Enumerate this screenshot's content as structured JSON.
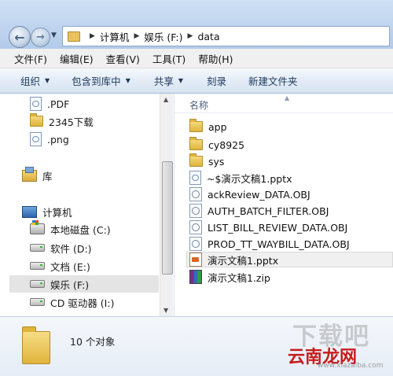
{
  "address": {
    "crumbs": [
      "计算机",
      "娱乐 (F:)",
      "data"
    ]
  },
  "menu": [
    "文件(F)",
    "编辑(E)",
    "查看(V)",
    "工具(T)",
    "帮助(H)"
  ],
  "commands": [
    {
      "label": "组织",
      "dropdown": true
    },
    {
      "label": "包含到库中",
      "dropdown": true
    },
    {
      "label": "共享",
      "dropdown": true
    },
    {
      "label": "刻录",
      "dropdown": false
    },
    {
      "label": "新建文件夹",
      "dropdown": false
    }
  ],
  "nav": {
    "items": [
      {
        "label": ".PDF",
        "icon": "file-icon"
      },
      {
        "label": "2345下载",
        "icon": "folder-icon"
      },
      {
        "label": ".png",
        "icon": "file-icon"
      },
      {
        "label": "库",
        "icon": "library-icon"
      },
      {
        "label": "计算机",
        "icon": "computer-icon"
      },
      {
        "label": "本地磁盘 (C:)",
        "icon": "system-drive-icon"
      },
      {
        "label": "软件 (D:)",
        "icon": "drive-icon"
      },
      {
        "label": "文档 (E:)",
        "icon": "drive-icon"
      },
      {
        "label": "娱乐 (F:)",
        "icon": "drive-icon"
      },
      {
        "label": "CD 驱动器 (I:)",
        "icon": "drive-icon"
      }
    ]
  },
  "files": {
    "column_name": "名称",
    "items": [
      {
        "name": "app",
        "icon": "folder-icon"
      },
      {
        "name": "cy8925",
        "icon": "folder-icon"
      },
      {
        "name": "sys",
        "icon": "folder-icon"
      },
      {
        "name": "~$演示文稿1.pptx",
        "icon": "document-icon"
      },
      {
        "name": "ackReview_DATA.OBJ",
        "icon": "obj-file-icon"
      },
      {
        "name": "AUTH_BATCH_FILTER.OBJ",
        "icon": "obj-file-icon"
      },
      {
        "name": "LIST_BILL_REVIEW_DATA.OBJ",
        "icon": "obj-file-icon"
      },
      {
        "name": "PROD_TT_WAYBILL_DATA.OBJ",
        "icon": "obj-file-icon"
      },
      {
        "name": "演示文稿1.pptx",
        "icon": "pptx-icon"
      },
      {
        "name": "演示文稿1.zip",
        "icon": "zip-icon"
      }
    ]
  },
  "status": {
    "item_count": "10 个对象"
  },
  "watermark": {
    "big": "下载吧",
    "logo": "云南龙网",
    "url": "www.xiazaiba.com"
  }
}
